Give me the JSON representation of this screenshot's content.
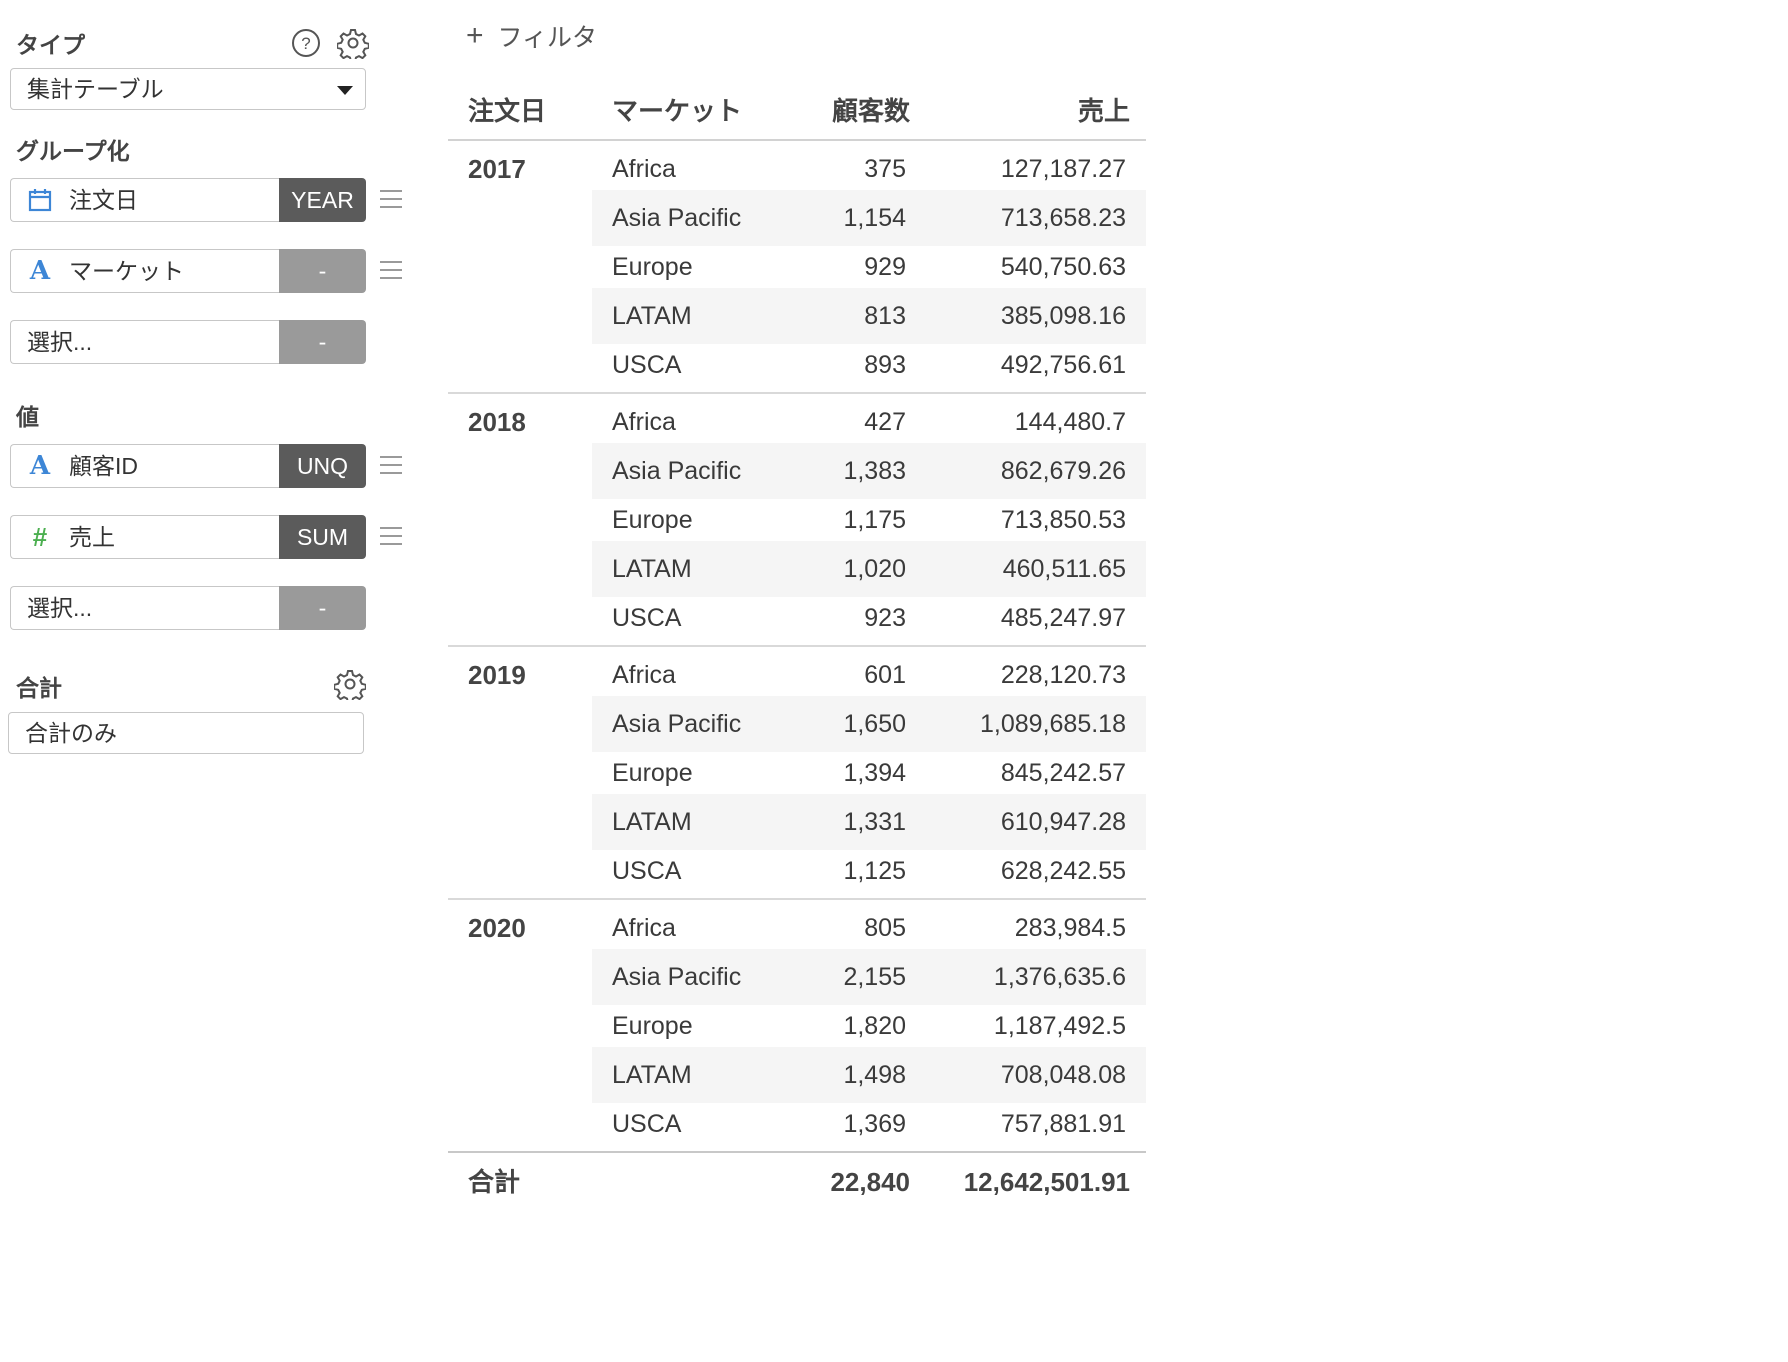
{
  "panel": {
    "type_label": "タイプ",
    "type_value": "集計テーブル",
    "group_label": "グループ化",
    "groups": [
      {
        "icon": "calendar-icon",
        "text": "注文日",
        "agg": "YEAR",
        "active": true
      },
      {
        "icon": "text-type-icon",
        "icon_char": "A",
        "text": "マーケット",
        "agg": "-",
        "active": false
      },
      {
        "icon": null,
        "text": "選択...",
        "agg": "-",
        "active": false
      }
    ],
    "values_label": "値",
    "values": [
      {
        "icon": "text-type-icon",
        "icon_char": "A",
        "text": "顧客ID",
        "agg": "UNQ",
        "active": true
      },
      {
        "icon": "number-type-icon",
        "icon_char": "#",
        "text": "売上",
        "agg": "SUM",
        "active": true
      },
      {
        "icon": null,
        "text": "選択...",
        "agg": "-",
        "active": false
      }
    ],
    "total_label": "合計",
    "total_value": "合計のみ"
  },
  "filter": {
    "label": "フィルタ"
  },
  "table": {
    "headers": {
      "date": "注文日",
      "market": "マーケット",
      "customers": "顧客数",
      "sales": "売上"
    },
    "groups": [
      {
        "year": "2017",
        "rows": [
          {
            "market": "Africa",
            "customers": "375",
            "sales": "127,187.27"
          },
          {
            "market": "Asia Pacific",
            "customers": "1,154",
            "sales": "713,658.23"
          },
          {
            "market": "Europe",
            "customers": "929",
            "sales": "540,750.63"
          },
          {
            "market": "LATAM",
            "customers": "813",
            "sales": "385,098.16"
          },
          {
            "market": "USCA",
            "customers": "893",
            "sales": "492,756.61"
          }
        ]
      },
      {
        "year": "2018",
        "rows": [
          {
            "market": "Africa",
            "customers": "427",
            "sales": "144,480.7"
          },
          {
            "market": "Asia Pacific",
            "customers": "1,383",
            "sales": "862,679.26"
          },
          {
            "market": "Europe",
            "customers": "1,175",
            "sales": "713,850.53"
          },
          {
            "market": "LATAM",
            "customers": "1,020",
            "sales": "460,511.65"
          },
          {
            "market": "USCA",
            "customers": "923",
            "sales": "485,247.97"
          }
        ]
      },
      {
        "year": "2019",
        "rows": [
          {
            "market": "Africa",
            "customers": "601",
            "sales": "228,120.73"
          },
          {
            "market": "Asia Pacific",
            "customers": "1,650",
            "sales": "1,089,685.18"
          },
          {
            "market": "Europe",
            "customers": "1,394",
            "sales": "845,242.57"
          },
          {
            "market": "LATAM",
            "customers": "1,331",
            "sales": "610,947.28"
          },
          {
            "market": "USCA",
            "customers": "1,125",
            "sales": "628,242.55"
          }
        ]
      },
      {
        "year": "2020",
        "rows": [
          {
            "market": "Africa",
            "customers": "805",
            "sales": "283,984.5"
          },
          {
            "market": "Asia Pacific",
            "customers": "2,155",
            "sales": "1,376,635.6"
          },
          {
            "market": "Europe",
            "customers": "1,820",
            "sales": "1,187,492.5"
          },
          {
            "market": "LATAM",
            "customers": "1,498",
            "sales": "708,048.08"
          },
          {
            "market": "USCA",
            "customers": "1,369",
            "sales": "757,881.91"
          }
        ]
      }
    ],
    "total": {
      "label": "合計",
      "customers": "22,840",
      "sales": "12,642,501.91"
    }
  }
}
